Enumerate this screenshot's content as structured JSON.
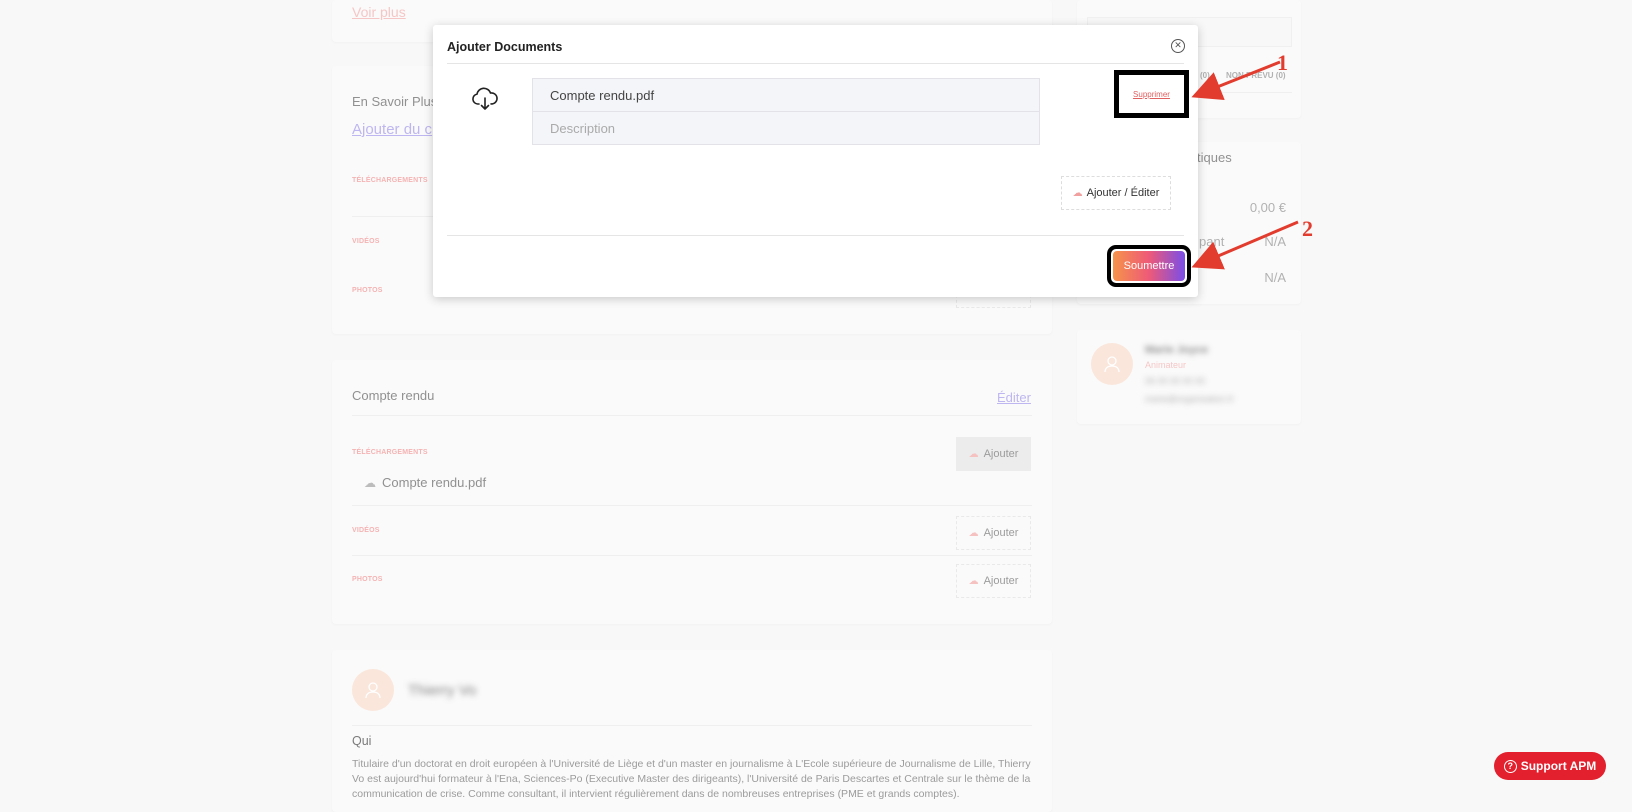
{
  "left": {
    "voir_plus": "Voir plus",
    "en_savoir_plus": {
      "title": "En Savoir Plus",
      "link": "Ajouter du c",
      "labels": [
        "TÉLÉCHARGEMENTS",
        "VIDÉOS",
        "PHOTOS"
      ]
    },
    "compte_rendu": {
      "title": "Compte rendu",
      "edit": "Éditer",
      "labels": [
        "TÉLÉCHARGEMENTS",
        "VIDÉOS",
        "PHOTOS"
      ],
      "add_label": "Ajouter",
      "file": "Compte rendu.pdf"
    },
    "speaker": {
      "name": "Thierry Vo",
      "qui": "Qui",
      "bio": "Titulaire d'un doctorat en droit européen à l'Université de Liège et d'un master en journalisme à L'Ecole supérieure de Journalisme de Lille, Thierry Vo est aujourd'hui formateur à l'Ena, Sciences-Po (Executive Master des dirigeants), l'Université de Paris Descartes et Centrale sur le thème de la communication de crise. Comme consultant, il intervient régulièrement dans de nombreuses entreprises (PME et grands comptes)."
    }
  },
  "right": {
    "tabs_partial": "(0)",
    "non_prevu": "NON PRÉVU (0)",
    "stats_title": "tiques",
    "price": "0,00 €",
    "pant": "pant",
    "na1": "N/A",
    "na2": "N/A",
    "contact": {
      "name": "Marie Joyce",
      "role": "Animateur",
      "phone": "06 00 00 00 00",
      "email": "marie@organisation.fr"
    }
  },
  "modal": {
    "title": "Ajouter Documents",
    "file_name": "Compte rendu.pdf",
    "description_placeholder": "Description",
    "delete": "Supprimer",
    "add_edit": "Ajouter / Éditer",
    "submit": "Soumettre"
  },
  "annotations": [
    "1",
    "2"
  ],
  "support": {
    "label": "Support APM"
  },
  "colors": {
    "accent_pink": "#f08a8a",
    "link_purple": "#9b8fe8",
    "annotation_red": "#e23c2e",
    "support_red": "#e3202e",
    "gradient": [
      "#f5934a",
      "#ee5a78",
      "#7a4de8"
    ]
  }
}
